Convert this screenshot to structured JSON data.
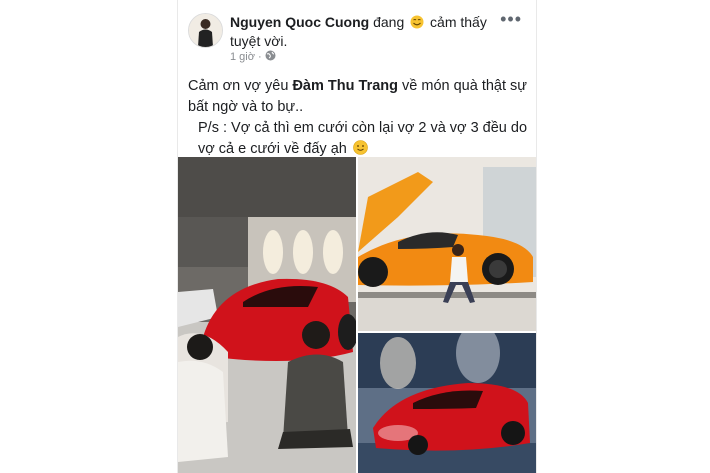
{
  "post": {
    "author": "Nguyen Quoc Cuong",
    "feeling_prefix": "đang",
    "feeling_text": "cảm thấy tuyệt vời.",
    "feeling_icon": "smiling-face-icon",
    "time": "1 giờ",
    "time_separator": "·",
    "privacy_icon": "globe-icon",
    "more_label": "•••",
    "text": {
      "line1_before": "Cảm ơn vợ yêu",
      "mention": "Đàm Thu Trang",
      "line1_after": "về món quà thật sự bất ngờ và to bự..",
      "line2": "P/s : Vợ cả thì em cưới còn lại vợ 2 và vợ 3 đều do vợ cả e cưới về đấy ạh",
      "emoji_icon": "slightly-smiling-face-icon"
    },
    "photos": [
      {
        "name": "garage-red-car-photo"
      },
      {
        "name": "orange-supercar-photo"
      },
      {
        "name": "red-supercar-studio-photo"
      }
    ]
  },
  "colors": {
    "text": "#1c1e21",
    "meta": "#8a8d91",
    "car_red": "#d0121b",
    "car_orange": "#f28a12"
  }
}
